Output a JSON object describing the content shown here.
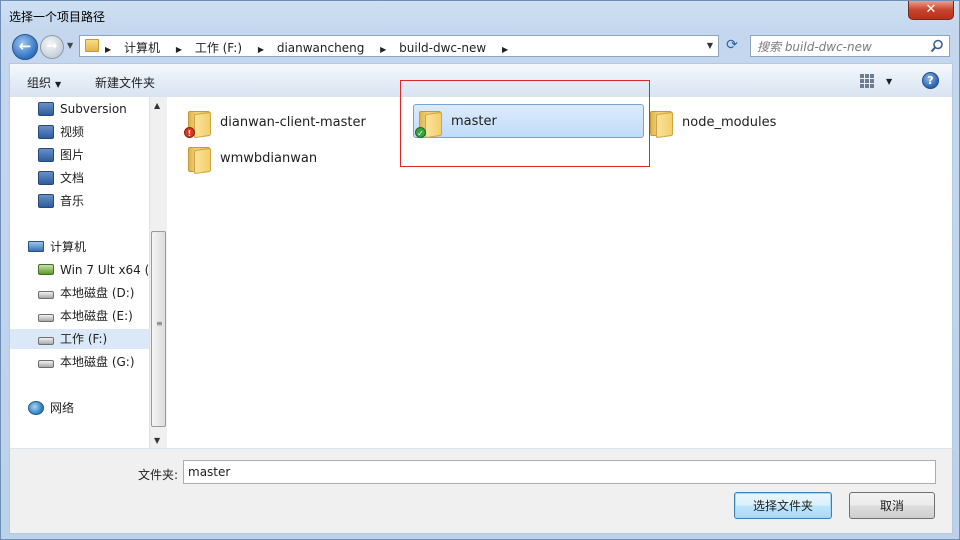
{
  "window": {
    "title": "选择一个项目路径",
    "close_label": "✕"
  },
  "address": {
    "crumbs": [
      "计算机",
      "工作 (F:)",
      "dianwancheng",
      "build-dwc-new"
    ]
  },
  "search": {
    "placeholder": "搜索 build-dwc-new"
  },
  "toolbar": {
    "organize_label": "组织",
    "new_folder_label": "新建文件夹"
  },
  "nav": {
    "items": [
      {
        "label": "Subversion",
        "icon": "library-icon"
      },
      {
        "label": "视频",
        "icon": "library-icon"
      },
      {
        "label": "图片",
        "icon": "library-icon"
      },
      {
        "label": "文档",
        "icon": "library-icon"
      },
      {
        "label": "音乐",
        "icon": "library-icon"
      },
      {
        "label": "计算机",
        "icon": "computer-icon"
      },
      {
        "label": "Win 7 Ult x64 (C",
        "icon": "system-drive-icon"
      },
      {
        "label": "本地磁盘 (D:)",
        "icon": "drive-icon"
      },
      {
        "label": "本地磁盘 (E:)",
        "icon": "drive-icon"
      },
      {
        "label": "工作 (F:)",
        "icon": "drive-icon"
      },
      {
        "label": "本地磁盘 (G:)",
        "icon": "drive-icon"
      },
      {
        "label": "网络",
        "icon": "network-icon"
      }
    ]
  },
  "files": [
    {
      "name": "dianwan-client-master",
      "badge": "!"
    },
    {
      "name": "master",
      "badge": "✓"
    },
    {
      "name": "node_modules",
      "badge": ""
    },
    {
      "name": "wmwbdianwan",
      "badge": ""
    }
  ],
  "footer": {
    "folder_label": "文件夹:",
    "folder_value": "master",
    "select_button": "选择文件夹",
    "cancel_button": "取消"
  },
  "colors": {
    "highlight_box": "#e02626",
    "selected_tile": "#c1dcfa"
  }
}
